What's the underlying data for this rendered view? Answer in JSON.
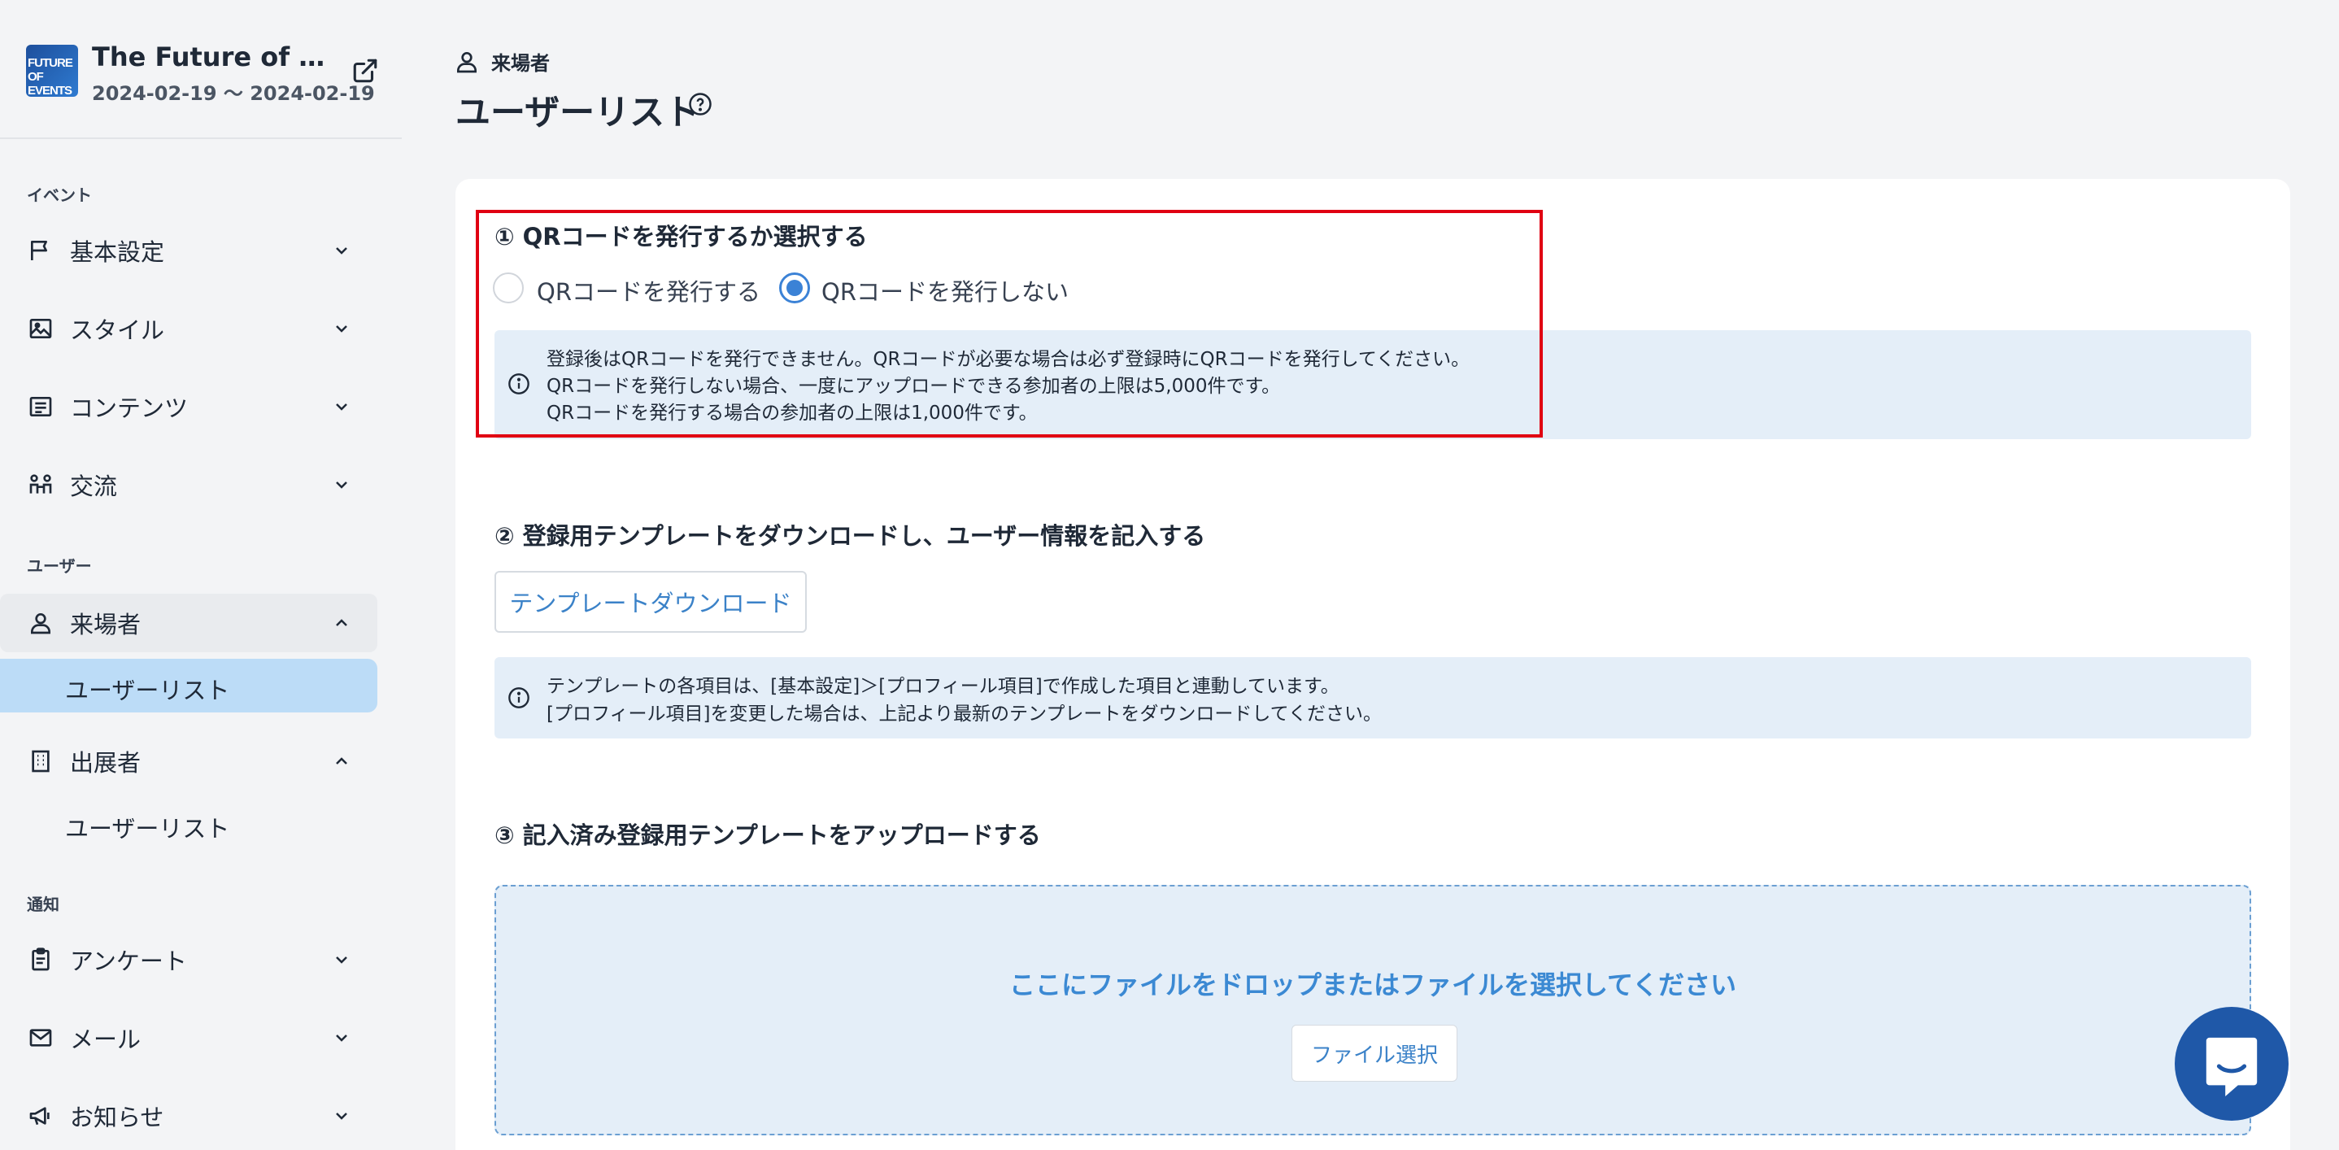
{
  "event": {
    "logo_line1": "FUTURE",
    "logo_line2": "OF EVENTS",
    "title": "The Future of Events",
    "dates": "2024-02-19 〜 2024-02-19"
  },
  "sidebar": {
    "section_event": "イベント",
    "section_user": "ユーザー",
    "section_notify": "通知",
    "items": {
      "basic_settings": "基本設定",
      "style": "スタイル",
      "contents": "コンテンツ",
      "exchange": "交流",
      "visitors": "来場者",
      "visitors_user_list": "ユーザーリスト",
      "exhibitors": "出展者",
      "exhibitors_user_list": "ユーザーリスト",
      "survey": "アンケート",
      "mail": "メール",
      "notice": "お知らせ"
    }
  },
  "header": {
    "breadcrumb": "来場者",
    "title": "ユーザーリスト"
  },
  "step1": {
    "title": "① QRコードを発行するか選択する",
    "option_issue": "QRコードを発行する",
    "option_no_issue": "QRコードを発行しない",
    "selected": "QRコードを発行しない",
    "info": [
      "登録後はQRコードを発行できません。QRコードが必要な場合は必ず登録時にQRコードを発行してください。",
      "QRコードを発行しない場合、一度にアップロードできる参加者の上限は5,000件です。",
      "QRコードを発行する場合の参加者の上限は1,000件です。"
    ]
  },
  "step2": {
    "title": "② 登録用テンプレートをダウンロードし、ユーザー情報を記入する",
    "download_button": "テンプレートダウンロード",
    "info": [
      "テンプレートの各項目は、[基本設定]＞[プロフィール項目]で作成した項目と連動しています。",
      "[プロフィール項目]を変更した場合は、上記より最新のテンプレートをダウンロードしてください。"
    ]
  },
  "step3": {
    "title": "③ 記入済み登録用テンプレートをアップロードする",
    "drop_text": "ここにファイルをドロップまたはファイルを選択してください",
    "file_button": "ファイル選択"
  },
  "colors": {
    "accent": "#3b82d6",
    "info_bg": "#e4eef8",
    "highlight": "#e00012",
    "chat": "#1f58a8"
  }
}
